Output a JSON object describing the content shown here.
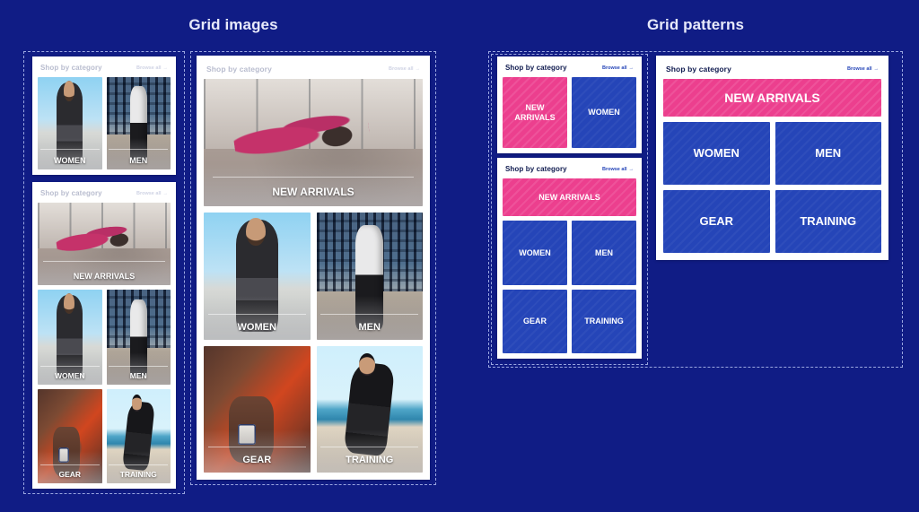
{
  "page": {
    "background_color": "#101c85"
  },
  "sections": {
    "grid_images_title": "Grid images",
    "grid_patterns_title": "Grid patterns"
  },
  "card_header": {
    "shop_label": "Shop by category",
    "browse_label": "Browse all",
    "browse_arrow": "→"
  },
  "colors": {
    "background": "#101c85",
    "tile_pink": "#ec3f8e",
    "tile_blue": "#2545b8",
    "card_white": "#ffffff",
    "dashed_border": "#9aa6e0",
    "title_text": "#e8eafb",
    "shop_label_text": "#0f1a4f",
    "browse_link_text": "#2545b8"
  },
  "labels": {
    "new_arrivals": "NEW ARRIVALS",
    "women": "WOMEN",
    "men": "MEN",
    "gear": "GEAR",
    "training": "TRAINING"
  },
  "grid_images": {
    "card_2up": {
      "tiles": [
        {
          "caption": "WOMEN",
          "scene": "women"
        },
        {
          "caption": "MEN",
          "scene": "men"
        }
      ]
    },
    "card_5up": {
      "hero": {
        "caption": "NEW ARRIVALS",
        "scene": "yoga"
      },
      "tiles": [
        {
          "caption": "WOMEN",
          "scene": "women"
        },
        {
          "caption": "MEN",
          "scene": "men"
        },
        {
          "caption": "GEAR",
          "scene": "gear"
        },
        {
          "caption": "TRAINING",
          "scene": "training"
        }
      ]
    },
    "card_large": {
      "hero": {
        "caption": "NEW ARRIVALS",
        "scene": "yoga"
      },
      "tiles": [
        {
          "caption": "WOMEN",
          "scene": "women"
        },
        {
          "caption": "MEN",
          "scene": "men"
        },
        {
          "caption": "GEAR",
          "scene": "gear"
        },
        {
          "caption": "TRAINING",
          "scene": "training"
        }
      ]
    }
  },
  "grid_patterns": {
    "card_2up": {
      "tiles": [
        {
          "label": "NEW\nARRIVALS",
          "line1": "NEW",
          "line2": "ARRIVALS",
          "color": "pink"
        },
        {
          "label": "WOMEN",
          "color": "blue"
        }
      ]
    },
    "card_5up": {
      "hero": {
        "label": "NEW ARRIVALS",
        "color": "pink"
      },
      "tiles": [
        {
          "label": "WOMEN",
          "color": "blue"
        },
        {
          "label": "MEN",
          "color": "blue"
        },
        {
          "label": "GEAR",
          "color": "blue"
        },
        {
          "label": "TRAINING",
          "color": "blue"
        }
      ]
    },
    "card_large": {
      "hero": {
        "label": "NEW ARRIVALS",
        "color": "pink"
      },
      "tiles": [
        {
          "label": "WOMEN",
          "color": "blue"
        },
        {
          "label": "MEN",
          "color": "blue"
        },
        {
          "label": "GEAR",
          "color": "blue"
        },
        {
          "label": "TRAINING",
          "color": "blue"
        }
      ]
    }
  }
}
